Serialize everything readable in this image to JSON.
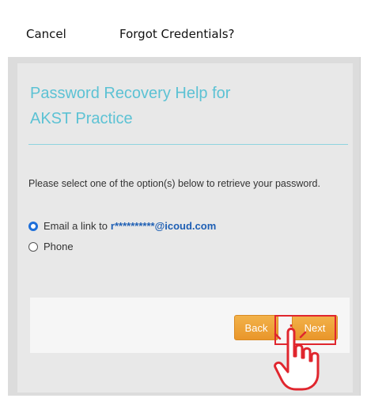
{
  "header": {
    "cancel_label": "Cancel",
    "title": "Forgot Credentials?"
  },
  "recovery": {
    "title_line1": "Password Recovery Help for",
    "title_line2": "AKST Practice",
    "instructions": "Please select one of the option(s) below to retrieve your password.",
    "options": [
      {
        "label": "Email a link to",
        "value": "r**********@icoud.com",
        "selected": true
      },
      {
        "label": "Phone",
        "selected": false
      }
    ]
  },
  "buttons": {
    "back_label": "Back",
    "next_label": "Next"
  },
  "colors": {
    "accent_title": "#5cc2d4",
    "button_orange": "#e9962a",
    "highlight_red": "#e0262e",
    "radio_selected": "#1e6fd9"
  },
  "icons": [
    "tap-hand-icon"
  ]
}
